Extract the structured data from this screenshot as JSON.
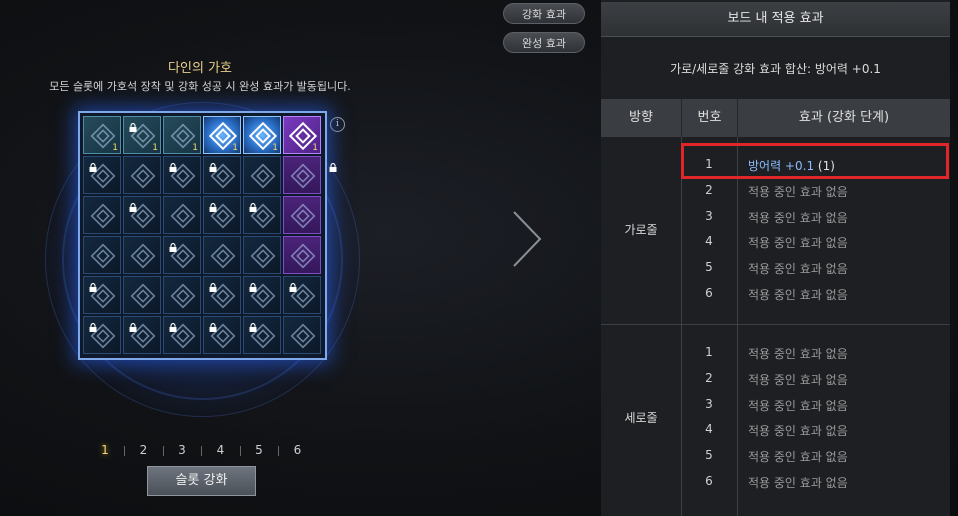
{
  "top_buttons": {
    "enhance_effect": "강화 효과",
    "complete_effect": "완성 효과"
  },
  "board": {
    "title": "다인의 가호",
    "description": "모든 슬롯에 가호석 장착 및 강화 성공 시 완성 효과가 발동됩니다.",
    "info_icon": "i",
    "top_row_counts": [
      "1",
      "1",
      "1",
      "1",
      "1",
      "1"
    ]
  },
  "pager": {
    "pages": [
      "1",
      "2",
      "3",
      "4",
      "5",
      "6"
    ],
    "selected": "1"
  },
  "enhance_button": "슬롯 강화",
  "panel": {
    "title": "보드 내 적용 효과",
    "summary": "가로/세로줄 강화 효과 합산: 방어력 +0.1",
    "headers": {
      "direction": "방향",
      "number": "번호",
      "effect": "효과 (강화 단계)"
    },
    "horizontal": {
      "label": "가로줄",
      "rows": [
        {
          "num": "1",
          "effect": "방어력 +0.1",
          "level": "(1)"
        },
        {
          "num": "2",
          "effect": "적용 중인 효과 없음"
        },
        {
          "num": "3",
          "effect": "적용 중인 효과 없음"
        },
        {
          "num": "4",
          "effect": "적용 중인 효과 없음"
        },
        {
          "num": "5",
          "effect": "적용 중인 효과 없음"
        },
        {
          "num": "6",
          "effect": "적용 중인 효과 없음"
        }
      ]
    },
    "vertical": {
      "label": "세로줄",
      "rows": [
        {
          "num": "1",
          "effect": "적용 중인 효과 없음"
        },
        {
          "num": "2",
          "effect": "적용 중인 효과 없음"
        },
        {
          "num": "3",
          "effect": "적용 중인 효과 없음"
        },
        {
          "num": "4",
          "effect": "적용 중인 효과 없음"
        },
        {
          "num": "5",
          "effect": "적용 중인 효과 없음"
        },
        {
          "num": "6",
          "effect": "적용 중인 효과 없음"
        }
      ]
    }
  },
  "colors": {
    "accent_gold": "#f3d774",
    "highlight_blue": "#8bbcff",
    "highlight_box": "#e0262b"
  }
}
